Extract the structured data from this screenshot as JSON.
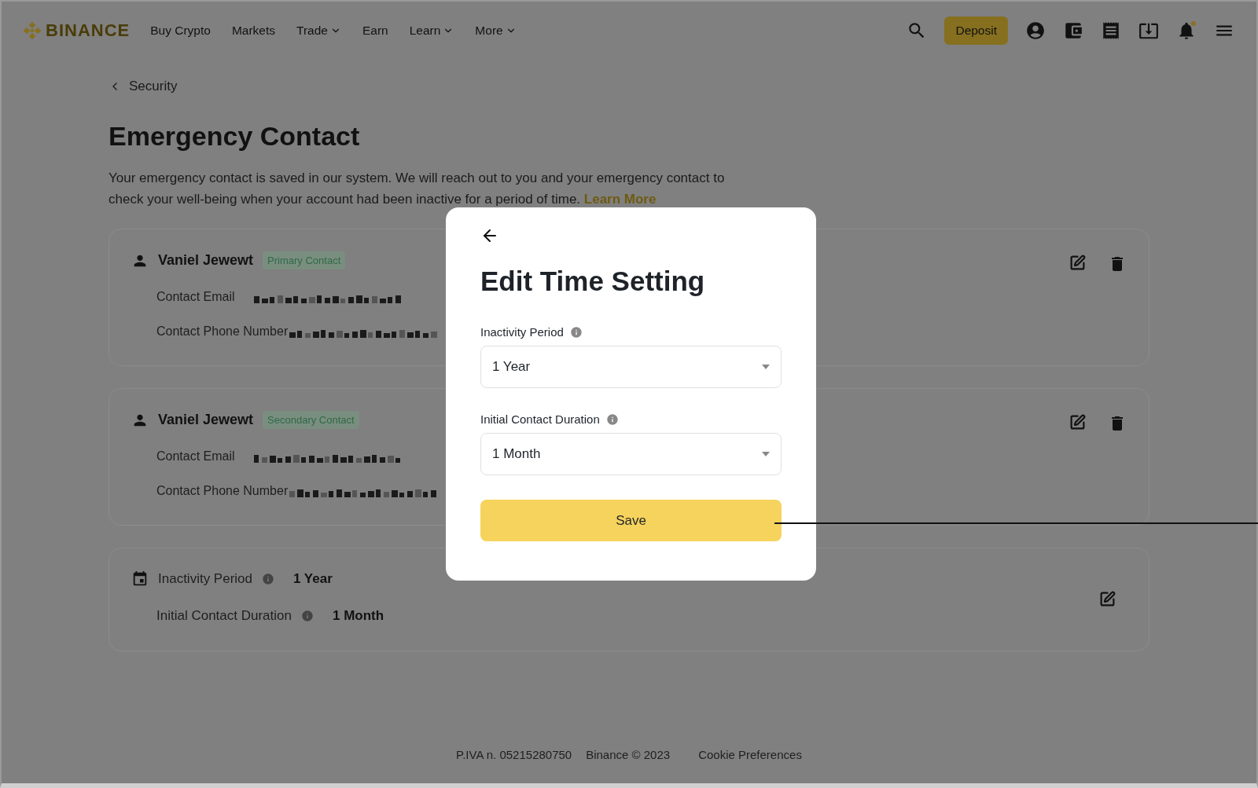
{
  "header": {
    "logo": "BINANCE",
    "nav": [
      {
        "label": "Buy Crypto",
        "has_menu": false
      },
      {
        "label": "Markets",
        "has_menu": false
      },
      {
        "label": "Trade",
        "has_menu": true
      },
      {
        "label": "Earn",
        "has_menu": false
      },
      {
        "label": "Learn",
        "has_menu": true
      },
      {
        "label": "More",
        "has_menu": true
      }
    ],
    "deposit": "Deposit",
    "has_notification": true
  },
  "breadcrumb": "Security",
  "title": "Emergency Contact",
  "description": "Your emergency contact is saved in our system. We will reach out to you and your emergency contact to check your well-being when your account had been inactive for a period of time.",
  "learn_more": "Learn More",
  "contacts": [
    {
      "name": "Vaniel Jewewt",
      "role": "Primary Contact",
      "email_label": "Contact Email",
      "phone_label": "Contact Phone Number"
    },
    {
      "name": "Vaniel Jewewt",
      "role": "Secondary Contact",
      "email_label": "Contact Email",
      "phone_label": "Contact Phone Number"
    }
  ],
  "time_settings": [
    {
      "label": "Inactivity Period",
      "value": "1 Year"
    },
    {
      "label": "Initial Contact Duration",
      "value": "1 Month"
    }
  ],
  "modal": {
    "title": "Edit Time Setting",
    "fields": [
      {
        "label": "Inactivity Period",
        "value": "1 Year"
      },
      {
        "label": "Initial Contact Duration",
        "value": "1 Month"
      }
    ],
    "save": "Save"
  },
  "footer": [
    "P.IVA n. 05215280750",
    "Binance © 2023",
    "Cookie Preferences"
  ]
}
